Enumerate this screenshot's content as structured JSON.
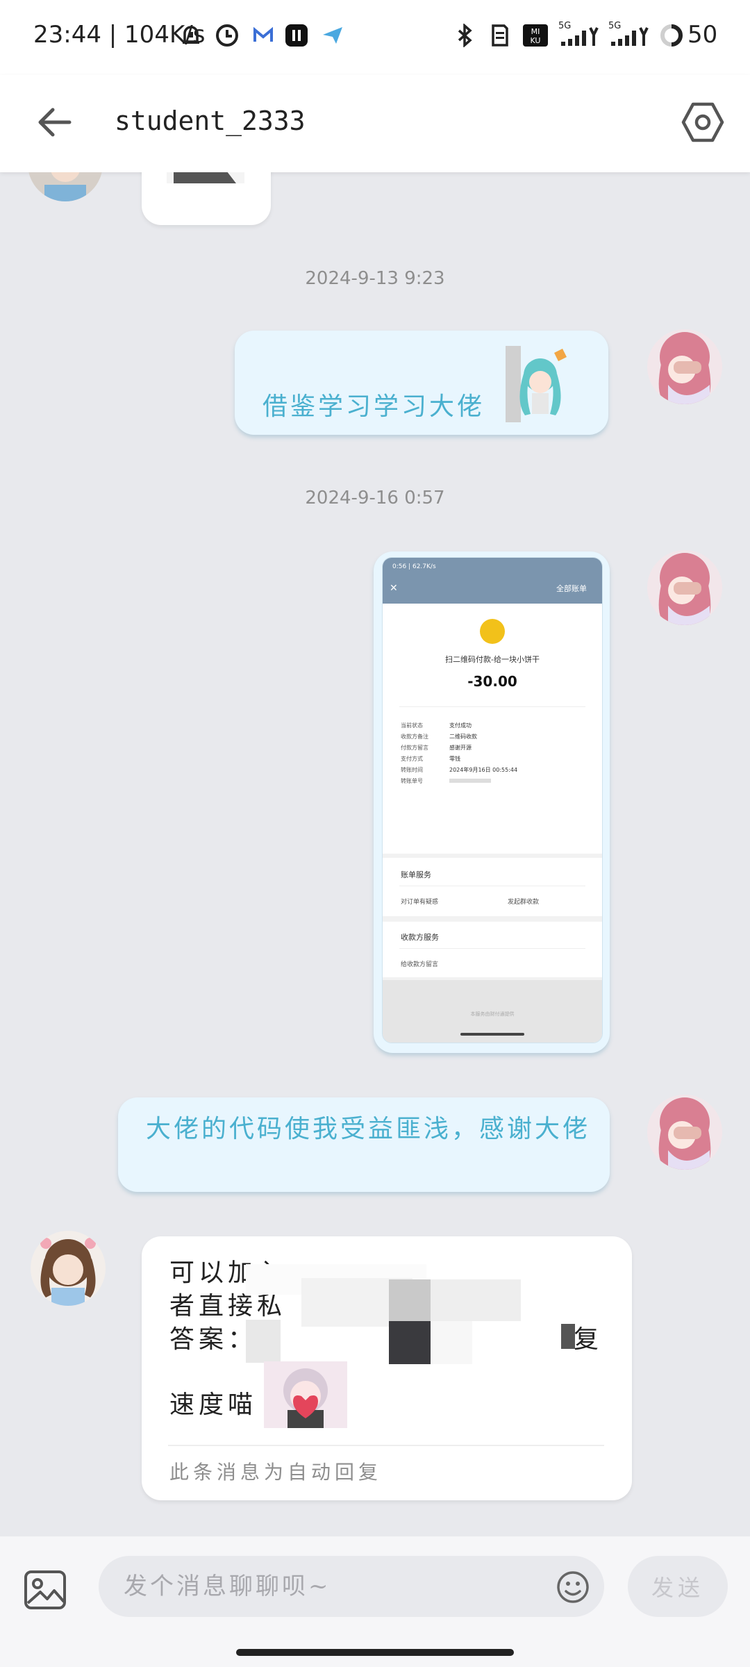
{
  "status_bar": {
    "time_speed": "23:44 | 104K/s",
    "battery": "50",
    "network_5g_1": "5G",
    "network_5g_2": "5G"
  },
  "header": {
    "title": "student_2333"
  },
  "messages": [
    {
      "timestamp": "2024-9-13 9:23"
    },
    {
      "text": "借鉴学习学习大佬"
    },
    {
      "timestamp": "2024-9-16 0:57"
    },
    {
      "receipt": {
        "mini_status": "0:56 | 62.7K/s",
        "all_bills": "全部账单",
        "merchant": "扫二维码付款-给一块小饼干",
        "amount": "-30.00",
        "rows": [
          {
            "label": "当前状态",
            "value": "支付成功"
          },
          {
            "label": "收款方备注",
            "value": "二维码收款"
          },
          {
            "label": "付款方留言",
            "value": "感谢开源"
          },
          {
            "label": "支付方式",
            "value": "零钱"
          },
          {
            "label": "转账时间",
            "value": "2024年9月16日 00:55:44"
          },
          {
            "label": "转账单号",
            "value": ""
          }
        ],
        "section1_title": "账单服务",
        "section1_item1": "对订单有疑惑",
        "section1_item2": "发起群收款",
        "section2_title": "收款方服务",
        "section2_item1": "给收款方留言",
        "footer": "本服务由财付通提供"
      }
    },
    {
      "text": "大佬的代码使我受益匪浅，感谢大佬"
    },
    {
      "lines": [
        "可以加入",
        "者直接私",
        "答案：因",
        "复",
        "速度喵"
      ],
      "auto_reply_note": "此条消息为自动回复"
    }
  ],
  "input_bar": {
    "placeholder": "发个消息聊聊呗~",
    "send_label": "发送"
  }
}
